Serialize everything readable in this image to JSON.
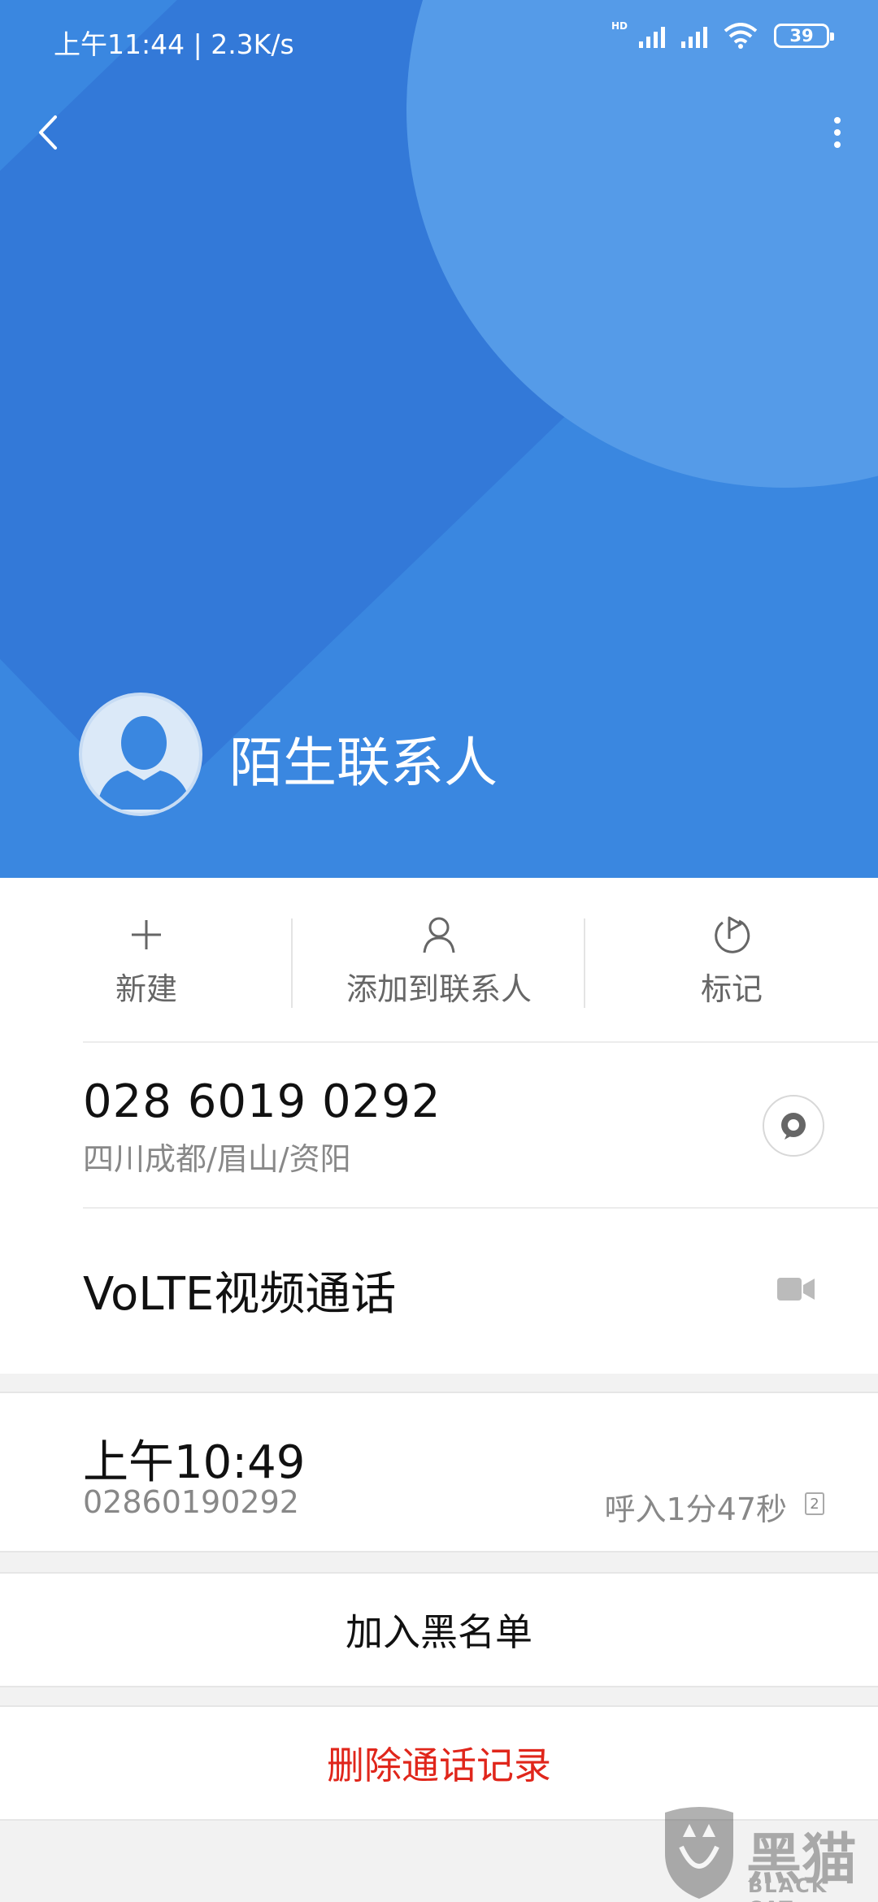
{
  "status_bar": {
    "time": "上午11:44 | 2.3K/s",
    "hd_label": "HD",
    "battery": "39",
    "icons": [
      "hd-signal-icon",
      "signal-icon",
      "wifi-icon",
      "battery-icon"
    ]
  },
  "toolbar": {
    "back_icon": "chevron-left-icon",
    "more_icon": "more-vertical-icon"
  },
  "contact": {
    "name": "陌生联系人",
    "avatar_icon": "person-avatar-icon"
  },
  "actions": [
    {
      "label": "新建",
      "icon": "plus-icon"
    },
    {
      "label": "添加到联系人",
      "icon": "person-icon"
    },
    {
      "label": "标记",
      "icon": "flag-icon"
    }
  ],
  "phone": {
    "number": "028 6019 0292",
    "location": "四川成都/眉山/资阳",
    "message_icon": "message-icon"
  },
  "video_call": {
    "label": "VoLTE视频通话",
    "icon": "video-camera-icon"
  },
  "call_log": {
    "time": "上午10:49",
    "number": "02860190292",
    "type_duration": "呼入1分47秒",
    "sim": "2"
  },
  "buttons": {
    "block": "加入黑名单",
    "delete": "删除通话记录"
  },
  "watermark": {
    "title": "黑猫",
    "subtitle": "BLACK CAT"
  },
  "colors": {
    "header_blue": "#3a87e0",
    "delete_red": "#e0261b"
  }
}
